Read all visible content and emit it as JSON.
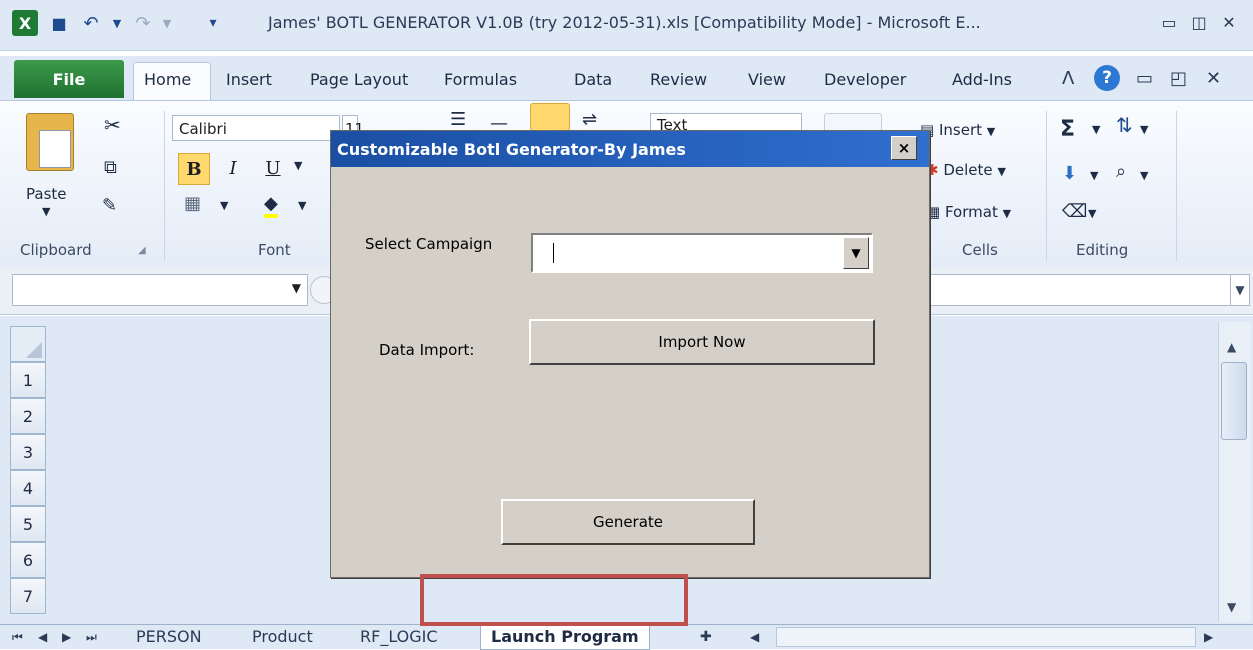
{
  "window": {
    "title": "James' BOTL GENERATOR V1.0B (try 2012-05-31).xls  [Compatibility Mode]  -  Microsoft E..."
  },
  "tabs": [
    {
      "label": "File"
    },
    {
      "label": "Home"
    },
    {
      "label": "Insert"
    },
    {
      "label": "Page Layout"
    },
    {
      "label": "Formulas"
    },
    {
      "label": "Data"
    },
    {
      "label": "Review"
    },
    {
      "label": "View"
    },
    {
      "label": "Developer"
    },
    {
      "label": "Add-Ins"
    }
  ],
  "ribbon": {
    "paste_label": "Paste",
    "clipboard_label": "Clipboard",
    "font_label": "Font",
    "font_name": "Calibri",
    "font_size": "11",
    "bold": "B",
    "italic": "I",
    "underline": "U",
    "number_format": "Text",
    "cells_label": "Cells",
    "insert_label": "Insert",
    "delete_label": "Delete",
    "format_label": "Format",
    "editing_label": "Editing"
  },
  "rows": [
    "1",
    "2",
    "3",
    "4",
    "5",
    "6",
    "7"
  ],
  "sheets": [
    {
      "label": "PERSON"
    },
    {
      "label": "Product"
    },
    {
      "label": "RF_LOGIC"
    },
    {
      "label": "Launch Program"
    }
  ],
  "dialog": {
    "title": "Customizable Botl Generator-By James",
    "close": "×",
    "campaign_label": "Select Campaign",
    "campaign_value": "",
    "import_label": "Data Import:",
    "import_button": "Import Now",
    "generate_button": "Generate"
  },
  "colors": {
    "dialog_title": "#1a4fa3",
    "file_tab": "#2c7a3a",
    "highlight": "#c0504d"
  }
}
